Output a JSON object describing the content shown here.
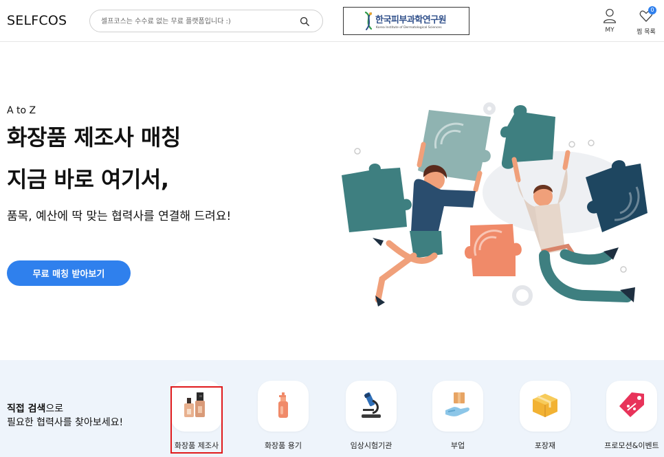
{
  "header": {
    "logo": "SELFCOS",
    "search_placeholder": "셀프코스는 수수료 없는 무료 플랫폼입니다 :)",
    "partner_name": "한국피부과학연구원",
    "partner_subtitle": "Korea Institute of Dermatological Sciences",
    "my_label": "MY",
    "wishlist_label": "찜 목록",
    "wishlist_count": "0"
  },
  "hero": {
    "eyebrow": "A to Z",
    "title_line1": "화장품 제조사 매칭",
    "title_line2": "지금 바로 여기서,",
    "description": "품목, 예산에 딱 맞는 협력사를 연결해 드려요!",
    "cta_label": "무료 매칭 받아보기",
    "cta_color": "#2f80ed"
  },
  "direct_search": {
    "bold": "직접 검색",
    "rest": "으로",
    "line2": "필요한 협력사를 찾아보세요!"
  },
  "categories": [
    {
      "label": "화장품 제조사",
      "icon": "foundation-bottles-icon"
    },
    {
      "label": "화장품 용기",
      "icon": "pump-bottle-icon"
    },
    {
      "label": "임상시험기관",
      "icon": "microscope-icon"
    },
    {
      "label": "부업",
      "icon": "hand-box-icon"
    },
    {
      "label": "포장재",
      "icon": "package-box-icon"
    },
    {
      "label": "프로모션&이벤트",
      "icon": "price-tag-icon"
    }
  ],
  "colors": {
    "accent": "#2f80ed",
    "band_background": "#eef4fb",
    "highlight_border": "#e0191b"
  }
}
